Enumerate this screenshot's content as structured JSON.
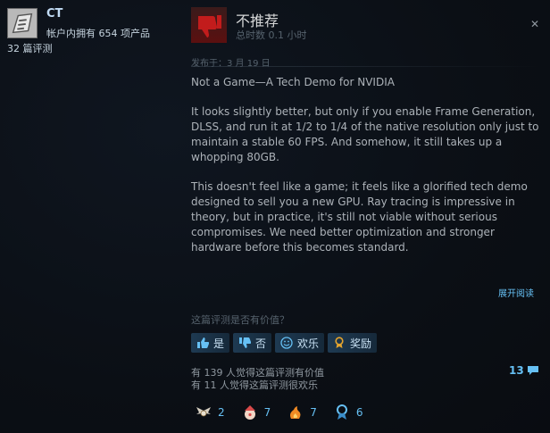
{
  "user": {
    "name": "CT",
    "products_owned": "帐户内拥有 654 项产品",
    "review_count": "32 篇评测"
  },
  "review": {
    "verdict": "不推荐",
    "hours": "总时数 0.1 小时",
    "posted": "发布于：3 月 19 日",
    "title": "Not a Game—A Tech Demo for NVIDIA",
    "paragraph_1": "It looks slightly better, but only if you enable Frame Generation, DLSS, and run it at 1/2 to 1/4 of the native resolution only just to maintain a stable 60 FPS. And somehow, it still takes up a whopping 80GB.",
    "paragraph_2": "This doesn't feel like a game; it feels like a glorified tech demo designed to sell you a new GPU. Ray tracing is impressive in theory, but in practice, it's still not viable without serious compromises. We need better optimization and stronger hardware before this becomes standard.",
    "expand_label": "展开阅读"
  },
  "helpful": {
    "question": "这篇评测是否有价值？",
    "yes_label": "是",
    "no_label": "否",
    "funny_label": "欢乐",
    "award_label": "奖励",
    "helpful_stat": "有 139 人觉得这篇评测有价值",
    "funny_stat": "有 11 人觉得这篇评测很欢乐",
    "comment_count": "13"
  },
  "awards": [
    {
      "icon": "winged-award-icon",
      "count": "2"
    },
    {
      "icon": "clown-award-icon",
      "count": "7"
    },
    {
      "icon": "hot-take-award-icon",
      "count": "7"
    },
    {
      "icon": "ribbon-award-icon",
      "count": "6"
    }
  ],
  "colors": {
    "accent": "#66c0f4",
    "background": "#0b0f15",
    "text": "#acb2b8",
    "thumb_red": "#c21c1c"
  }
}
